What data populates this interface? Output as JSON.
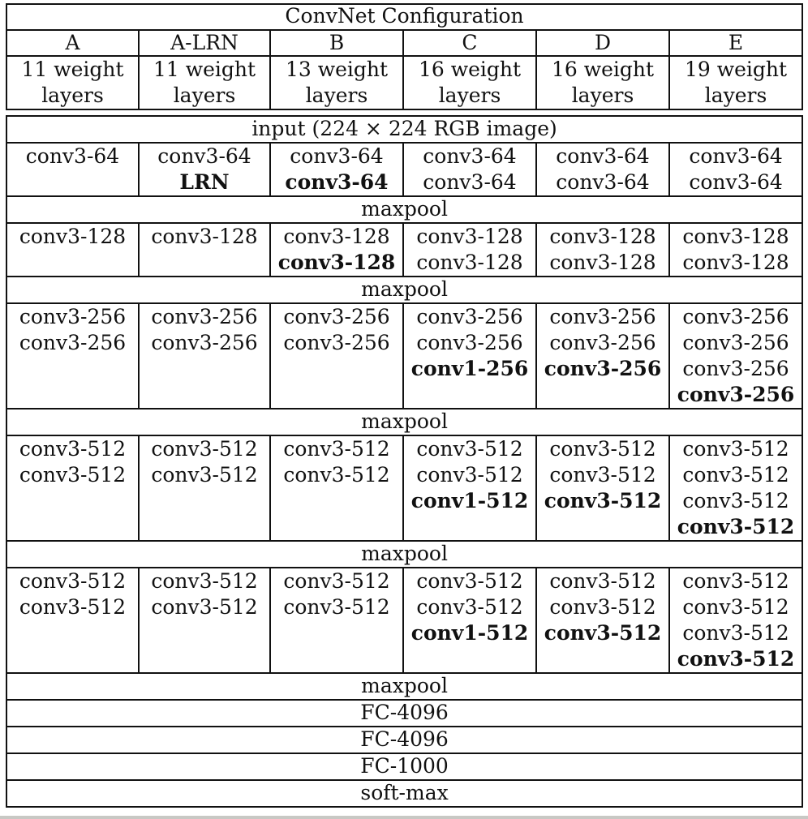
{
  "title": "ConvNet Configuration",
  "columns": [
    {
      "name": "A",
      "desc_line1": "11 weight",
      "desc_line2": "layers"
    },
    {
      "name": "A-LRN",
      "desc_line1": "11 weight",
      "desc_line2": "layers"
    },
    {
      "name": "B",
      "desc_line1": "13 weight",
      "desc_line2": "layers"
    },
    {
      "name": "C",
      "desc_line1": "16 weight",
      "desc_line2": "layers"
    },
    {
      "name": "D",
      "desc_line1": "16 weight",
      "desc_line2": "layers"
    },
    {
      "name": "E",
      "desc_line1": "19 weight",
      "desc_line2": "layers"
    }
  ],
  "input_row": "input (224 × 224 RGB image)",
  "blocks": [
    {
      "cells": [
        [
          {
            "t": "conv3-64",
            "b": false
          }
        ],
        [
          {
            "t": "conv3-64",
            "b": false
          },
          {
            "t": "LRN",
            "b": true
          }
        ],
        [
          {
            "t": "conv3-64",
            "b": false
          },
          {
            "t": "conv3-64",
            "b": true
          }
        ],
        [
          {
            "t": "conv3-64",
            "b": false
          },
          {
            "t": "conv3-64",
            "b": false
          }
        ],
        [
          {
            "t": "conv3-64",
            "b": false
          },
          {
            "t": "conv3-64",
            "b": false
          }
        ],
        [
          {
            "t": "conv3-64",
            "b": false
          },
          {
            "t": "conv3-64",
            "b": false
          }
        ]
      ],
      "pool": "maxpool"
    },
    {
      "cells": [
        [
          {
            "t": "conv3-128",
            "b": false
          }
        ],
        [
          {
            "t": "conv3-128",
            "b": false
          }
        ],
        [
          {
            "t": "conv3-128",
            "b": false
          },
          {
            "t": "conv3-128",
            "b": true
          }
        ],
        [
          {
            "t": "conv3-128",
            "b": false
          },
          {
            "t": "conv3-128",
            "b": false
          }
        ],
        [
          {
            "t": "conv3-128",
            "b": false
          },
          {
            "t": "conv3-128",
            "b": false
          }
        ],
        [
          {
            "t": "conv3-128",
            "b": false
          },
          {
            "t": "conv3-128",
            "b": false
          }
        ]
      ],
      "pool": "maxpool"
    },
    {
      "cells": [
        [
          {
            "t": "conv3-256",
            "b": false
          },
          {
            "t": "conv3-256",
            "b": false
          }
        ],
        [
          {
            "t": "conv3-256",
            "b": false
          },
          {
            "t": "conv3-256",
            "b": false
          }
        ],
        [
          {
            "t": "conv3-256",
            "b": false
          },
          {
            "t": "conv3-256",
            "b": false
          }
        ],
        [
          {
            "t": "conv3-256",
            "b": false
          },
          {
            "t": "conv3-256",
            "b": false
          },
          {
            "t": "conv1-256",
            "b": true
          }
        ],
        [
          {
            "t": "conv3-256",
            "b": false
          },
          {
            "t": "conv3-256",
            "b": false
          },
          {
            "t": "conv3-256",
            "b": true
          }
        ],
        [
          {
            "t": "conv3-256",
            "b": false
          },
          {
            "t": "conv3-256",
            "b": false
          },
          {
            "t": "conv3-256",
            "b": false
          },
          {
            "t": "conv3-256",
            "b": true
          }
        ]
      ],
      "pool": "maxpool"
    },
    {
      "cells": [
        [
          {
            "t": "conv3-512",
            "b": false
          },
          {
            "t": "conv3-512",
            "b": false
          }
        ],
        [
          {
            "t": "conv3-512",
            "b": false
          },
          {
            "t": "conv3-512",
            "b": false
          }
        ],
        [
          {
            "t": "conv3-512",
            "b": false
          },
          {
            "t": "conv3-512",
            "b": false
          }
        ],
        [
          {
            "t": "conv3-512",
            "b": false
          },
          {
            "t": "conv3-512",
            "b": false
          },
          {
            "t": "conv1-512",
            "b": true
          }
        ],
        [
          {
            "t": "conv3-512",
            "b": false
          },
          {
            "t": "conv3-512",
            "b": false
          },
          {
            "t": "conv3-512",
            "b": true
          }
        ],
        [
          {
            "t": "conv3-512",
            "b": false
          },
          {
            "t": "conv3-512",
            "b": false
          },
          {
            "t": "conv3-512",
            "b": false
          },
          {
            "t": "conv3-512",
            "b": true
          }
        ]
      ],
      "pool": "maxpool"
    },
    {
      "cells": [
        [
          {
            "t": "conv3-512",
            "b": false
          },
          {
            "t": "conv3-512",
            "b": false
          }
        ],
        [
          {
            "t": "conv3-512",
            "b": false
          },
          {
            "t": "conv3-512",
            "b": false
          }
        ],
        [
          {
            "t": "conv3-512",
            "b": false
          },
          {
            "t": "conv3-512",
            "b": false
          }
        ],
        [
          {
            "t": "conv3-512",
            "b": false
          },
          {
            "t": "conv3-512",
            "b": false
          },
          {
            "t": "conv1-512",
            "b": true
          }
        ],
        [
          {
            "t": "conv3-512",
            "b": false
          },
          {
            "t": "conv3-512",
            "b": false
          },
          {
            "t": "conv3-512",
            "b": true
          }
        ],
        [
          {
            "t": "conv3-512",
            "b": false
          },
          {
            "t": "conv3-512",
            "b": false
          },
          {
            "t": "conv3-512",
            "b": false
          },
          {
            "t": "conv3-512",
            "b": true
          }
        ]
      ],
      "pool": "maxpool"
    }
  ],
  "final_rows": [
    "FC-4096",
    "FC-4096",
    "FC-1000",
    "soft-max"
  ]
}
